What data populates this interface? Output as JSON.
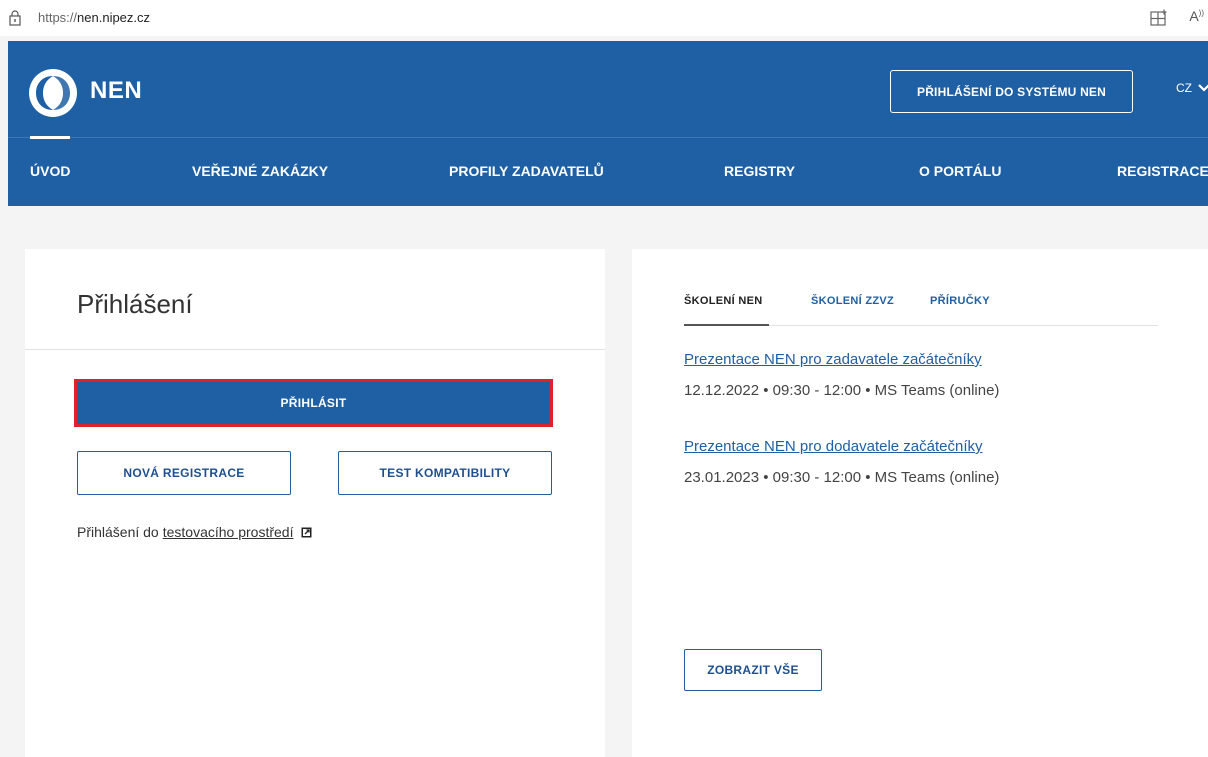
{
  "browser": {
    "url_prefix": "https://",
    "url_host": "nen.nipez.cz",
    "reader_label": "A"
  },
  "header": {
    "brand": "NEN",
    "login_system_label": "PŘIHLÁŠENÍ DO SYSTÉMU NEN",
    "language": "CZ",
    "nav": [
      {
        "label": "ÚVOD"
      },
      {
        "label": "VEŘEJNÉ ZAKÁZKY"
      },
      {
        "label": "PROFILY ZADAVATELŮ"
      },
      {
        "label": "REGISTRY"
      },
      {
        "label": "O PORTÁLU"
      },
      {
        "label": "REGISTRACE"
      }
    ]
  },
  "login": {
    "title": "Přihlášení",
    "login_button": "PŘIHLÁSIT",
    "new_registration": "NOVÁ REGISTRACE",
    "compat_test": "TEST KOMPATIBILITY",
    "test_env_prefix": "Přihlášení do",
    "test_env_link": "testovacího prostředí"
  },
  "training": {
    "tabs": [
      {
        "label": "ŠKOLENÍ NEN"
      },
      {
        "label": "ŠKOLENÍ ZZVZ"
      },
      {
        "label": "PŘÍRUČKY"
      }
    ],
    "events": [
      {
        "title": "Prezentace NEN pro zadavatele začátečníky",
        "meta": "12.12.2022 • 09:30 - 12:00 • MS Teams (online)"
      },
      {
        "title": "Prezentace NEN pro dodavatele začátečníky",
        "meta": "23.01.2023 • 09:30 - 12:00 • MS Teams (online)"
      }
    ],
    "show_all": "ZOBRAZIT VŠE"
  },
  "colors": {
    "brand_blue": "#1f5fa3",
    "highlight_red": "#e0202a"
  }
}
